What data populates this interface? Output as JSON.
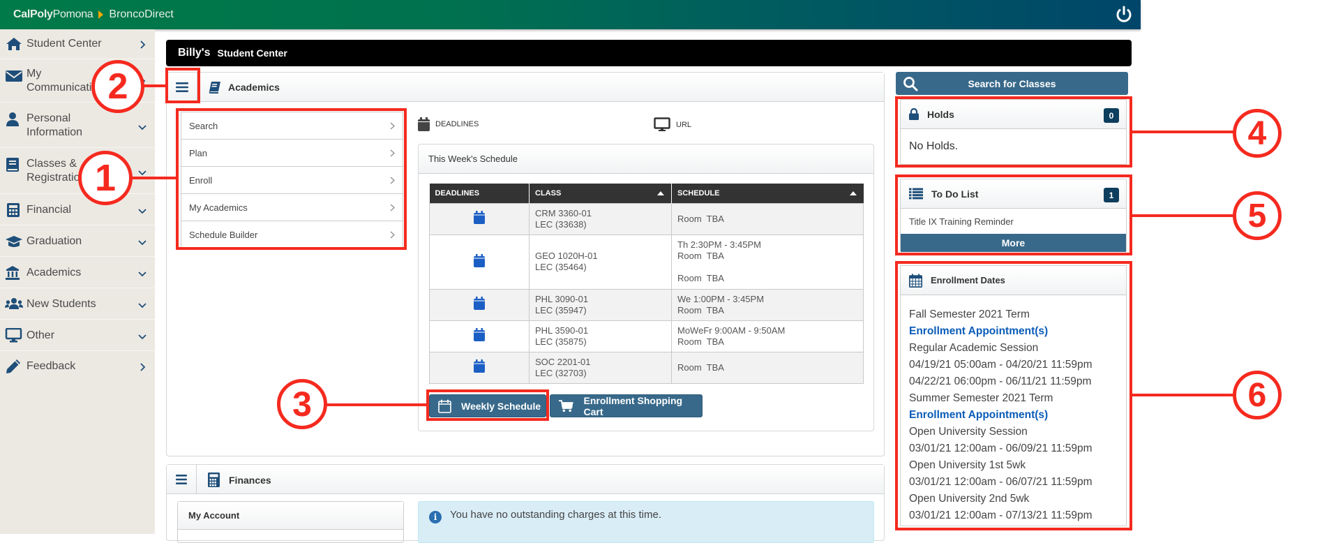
{
  "header": {
    "brand_bold": "CalPoly",
    "brand_light": "Pomona",
    "app_name": "BroncoDirect",
    "power_icon": "power-icon"
  },
  "sidebar": {
    "items": [
      {
        "label": "Student Center",
        "icon": "home-icon",
        "chevron": "right"
      },
      {
        "label": "My Communications",
        "line1": "My",
        "line2": "Communications",
        "icon": "envelope-icon",
        "chevron": "right"
      },
      {
        "label": "Personal Information",
        "line1": "Personal",
        "line2": "Information",
        "icon": "user-icon",
        "chevron": "down"
      },
      {
        "label": "Classes & Registration",
        "line1": "Classes &",
        "line2": "Registration",
        "icon": "book-icon",
        "chevron": "down"
      },
      {
        "label": "Financial",
        "icon": "calculator-icon",
        "chevron": "down"
      },
      {
        "label": "Graduation",
        "icon": "graduation-cap-icon",
        "chevron": "down"
      },
      {
        "label": "Academics",
        "icon": "university-icon",
        "chevron": "down"
      },
      {
        "label": "New Students",
        "icon": "users-icon",
        "chevron": "down"
      },
      {
        "label": "Other",
        "icon": "desktop-icon",
        "chevron": "down"
      },
      {
        "label": "Feedback",
        "icon": "pencil-icon",
        "chevron": "right"
      }
    ]
  },
  "welcome": {
    "name": "Billy's",
    "title": "Student Center"
  },
  "academics": {
    "title": "Academics",
    "menu": [
      "Search",
      "Plan",
      "Enroll",
      "My Academics",
      "Schedule Builder"
    ],
    "links": {
      "deadlines": "DEADLINES",
      "url": "URL"
    },
    "schedule": {
      "title": "This Week's Schedule",
      "columns": [
        "DEADLINES",
        "CLASS",
        "SCHEDULE"
      ],
      "rows": [
        {
          "class1": "CRM 3360-01",
          "class2": "LEC (33638)",
          "schedule": [
            "Room  TBA"
          ]
        },
        {
          "class1": "GEO 1020H-01",
          "class2": "LEC (35464)",
          "schedule": [
            "Th 2:30PM - 3:45PM",
            "Room  TBA",
            "",
            "Room  TBA"
          ]
        },
        {
          "class1": "PHL 3090-01",
          "class2": "LEC (35947)",
          "schedule": [
            "We 1:00PM - 3:45PM",
            "Room  TBA"
          ]
        },
        {
          "class1": "PHL 3590-01",
          "class2": "LEC (35875)",
          "schedule": [
            "MoWeFr 9:00AM - 9:50AM",
            "Room  TBA"
          ]
        },
        {
          "class1": "SOC 2201-01",
          "class2": "LEC (32703)",
          "schedule": [
            "Room  TBA"
          ]
        }
      ]
    },
    "buttons": {
      "weekly": "Weekly Schedule",
      "cart": "Enrollment Shopping Cart"
    }
  },
  "finances": {
    "title": "Finances",
    "my_account": "My Account",
    "message": "You have no outstanding charges at this time."
  },
  "right": {
    "search_button": "Search for Classes",
    "holds": {
      "title": "Holds",
      "count": "0",
      "body": "No Holds."
    },
    "todo": {
      "title": "To Do List",
      "count": "1",
      "item": "Title IX Training Reminder",
      "more": "More"
    },
    "enrollment": {
      "title": "Enrollment Dates",
      "lines": [
        {
          "text": "Fall Semester 2021 Term",
          "link": false
        },
        {
          "text": "Enrollment Appointment(s)",
          "link": true
        },
        {
          "text": "Regular Academic Session",
          "link": false
        },
        {
          "text": "04/19/21 05:00am - 04/20/21 11:59pm",
          "link": false
        },
        {
          "text": "04/22/21 06:00pm - 06/11/21 11:59pm",
          "link": false
        },
        {
          "text": "Summer Semester 2021 Term",
          "link": false
        },
        {
          "text": "Enrollment Appointment(s)",
          "link": true
        },
        {
          "text": "Open University Session",
          "link": false
        },
        {
          "text": "03/01/21 12:00am - 06/09/21 11:59pm",
          "link": false
        },
        {
          "text": "Open University 1st 5wk",
          "link": false
        },
        {
          "text": "03/01/21 12:00am - 06/07/21 11:59pm",
          "link": false
        },
        {
          "text": "Open University 2nd 5wk",
          "link": false
        },
        {
          "text": "03/01/21 12:00am - 07/13/21 11:59pm",
          "link": false
        }
      ]
    }
  },
  "annotations": [
    "1",
    "2",
    "3",
    "4",
    "5",
    "6"
  ],
  "colors": {
    "brand_green": "#007a48",
    "brand_blue": "#00466a",
    "button_blue": "#38698a",
    "annotation_red": "#f52a1f",
    "link_blue": "#0a5cb8",
    "badge_navy": "#0e3e5e"
  }
}
